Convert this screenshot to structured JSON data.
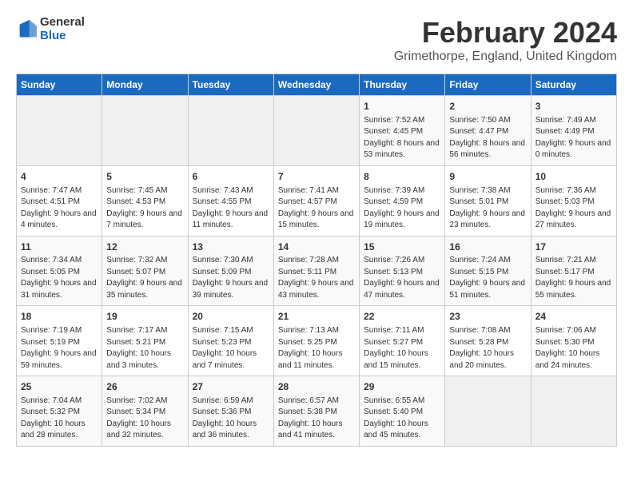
{
  "app": {
    "name_general": "General",
    "name_blue": "Blue"
  },
  "header": {
    "title": "February 2024",
    "subtitle": "Grimethorpe, England, United Kingdom"
  },
  "columns": [
    "Sunday",
    "Monday",
    "Tuesday",
    "Wednesday",
    "Thursday",
    "Friday",
    "Saturday"
  ],
  "rows": [
    [
      {
        "day": "",
        "empty": true
      },
      {
        "day": "",
        "empty": true
      },
      {
        "day": "",
        "empty": true
      },
      {
        "day": "",
        "empty": true
      },
      {
        "day": "1",
        "sunrise": "7:52 AM",
        "sunset": "4:45 PM",
        "daylight": "8 hours and 53 minutes."
      },
      {
        "day": "2",
        "sunrise": "7:50 AM",
        "sunset": "4:47 PM",
        "daylight": "8 hours and 56 minutes."
      },
      {
        "day": "3",
        "sunrise": "7:49 AM",
        "sunset": "4:49 PM",
        "daylight": "9 hours and 0 minutes."
      }
    ],
    [
      {
        "day": "4",
        "sunrise": "7:47 AM",
        "sunset": "4:51 PM",
        "daylight": "9 hours and 4 minutes."
      },
      {
        "day": "5",
        "sunrise": "7:45 AM",
        "sunset": "4:53 PM",
        "daylight": "9 hours and 7 minutes."
      },
      {
        "day": "6",
        "sunrise": "7:43 AM",
        "sunset": "4:55 PM",
        "daylight": "9 hours and 11 minutes."
      },
      {
        "day": "7",
        "sunrise": "7:41 AM",
        "sunset": "4:57 PM",
        "daylight": "9 hours and 15 minutes."
      },
      {
        "day": "8",
        "sunrise": "7:39 AM",
        "sunset": "4:59 PM",
        "daylight": "9 hours and 19 minutes."
      },
      {
        "day": "9",
        "sunrise": "7:38 AM",
        "sunset": "5:01 PM",
        "daylight": "9 hours and 23 minutes."
      },
      {
        "day": "10",
        "sunrise": "7:36 AM",
        "sunset": "5:03 PM",
        "daylight": "9 hours and 27 minutes."
      }
    ],
    [
      {
        "day": "11",
        "sunrise": "7:34 AM",
        "sunset": "5:05 PM",
        "daylight": "9 hours and 31 minutes."
      },
      {
        "day": "12",
        "sunrise": "7:32 AM",
        "sunset": "5:07 PM",
        "daylight": "9 hours and 35 minutes."
      },
      {
        "day": "13",
        "sunrise": "7:30 AM",
        "sunset": "5:09 PM",
        "daylight": "9 hours and 39 minutes."
      },
      {
        "day": "14",
        "sunrise": "7:28 AM",
        "sunset": "5:11 PM",
        "daylight": "9 hours and 43 minutes."
      },
      {
        "day": "15",
        "sunrise": "7:26 AM",
        "sunset": "5:13 PM",
        "daylight": "9 hours and 47 minutes."
      },
      {
        "day": "16",
        "sunrise": "7:24 AM",
        "sunset": "5:15 PM",
        "daylight": "9 hours and 51 minutes."
      },
      {
        "day": "17",
        "sunrise": "7:21 AM",
        "sunset": "5:17 PM",
        "daylight": "9 hours and 55 minutes."
      }
    ],
    [
      {
        "day": "18",
        "sunrise": "7:19 AM",
        "sunset": "5:19 PM",
        "daylight": "9 hours and 59 minutes."
      },
      {
        "day": "19",
        "sunrise": "7:17 AM",
        "sunset": "5:21 PM",
        "daylight": "10 hours and 3 minutes."
      },
      {
        "day": "20",
        "sunrise": "7:15 AM",
        "sunset": "5:23 PM",
        "daylight": "10 hours and 7 minutes."
      },
      {
        "day": "21",
        "sunrise": "7:13 AM",
        "sunset": "5:25 PM",
        "daylight": "10 hours and 11 minutes."
      },
      {
        "day": "22",
        "sunrise": "7:11 AM",
        "sunset": "5:27 PM",
        "daylight": "10 hours and 15 minutes."
      },
      {
        "day": "23",
        "sunrise": "7:08 AM",
        "sunset": "5:28 PM",
        "daylight": "10 hours and 20 minutes."
      },
      {
        "day": "24",
        "sunrise": "7:06 AM",
        "sunset": "5:30 PM",
        "daylight": "10 hours and 24 minutes."
      }
    ],
    [
      {
        "day": "25",
        "sunrise": "7:04 AM",
        "sunset": "5:32 PM",
        "daylight": "10 hours and 28 minutes."
      },
      {
        "day": "26",
        "sunrise": "7:02 AM",
        "sunset": "5:34 PM",
        "daylight": "10 hours and 32 minutes."
      },
      {
        "day": "27",
        "sunrise": "6:59 AM",
        "sunset": "5:36 PM",
        "daylight": "10 hours and 36 minutes."
      },
      {
        "day": "28",
        "sunrise": "6:57 AM",
        "sunset": "5:38 PM",
        "daylight": "10 hours and 41 minutes."
      },
      {
        "day": "29",
        "sunrise": "6:55 AM",
        "sunset": "5:40 PM",
        "daylight": "10 hours and 45 minutes."
      },
      {
        "day": "",
        "empty": true
      },
      {
        "day": "",
        "empty": true
      }
    ]
  ]
}
